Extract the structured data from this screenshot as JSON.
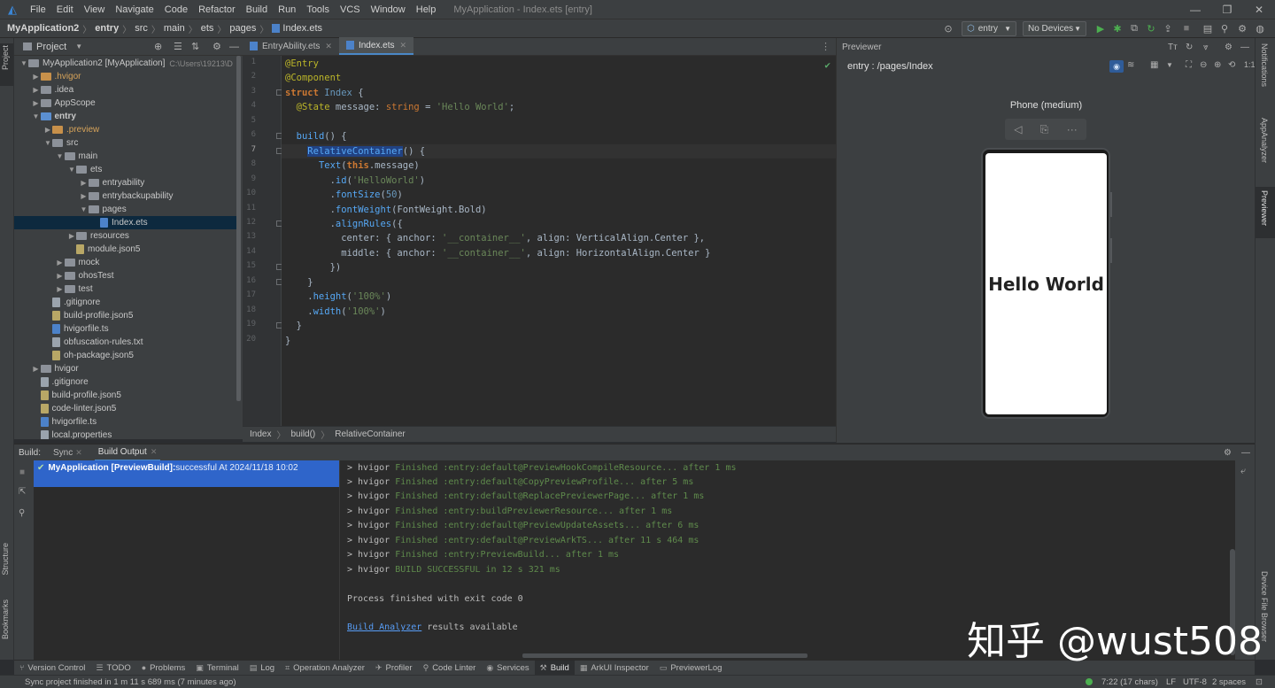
{
  "menubar": {
    "items": [
      "File",
      "Edit",
      "View",
      "Navigate",
      "Code",
      "Refactor",
      "Build",
      "Run",
      "Tools",
      "VCS",
      "Window",
      "Help"
    ],
    "title": "MyApplication - Index.ets [entry]"
  },
  "navbar": {
    "crumbs": [
      "MyApplication2",
      "entry",
      "src",
      "main",
      "ets",
      "pages",
      "Index.ets"
    ],
    "run_config": "entry",
    "device": "No Devices"
  },
  "left_strip": {
    "project": "Project",
    "structure": "Structure",
    "bookmarks": "Bookmarks"
  },
  "project_panel": {
    "title": "Project",
    "tree": [
      {
        "label": "MyApplication2 [MyApplication]",
        "extra": "C:\\Users\\19213\\D",
        "depth": 0,
        "kind": "folder",
        "open": true,
        "bold_part": "[MyApplication]"
      },
      {
        "label": ".hvigor",
        "depth": 1,
        "kind": "folder-orange",
        "open": false
      },
      {
        "label": ".idea",
        "depth": 1,
        "kind": "folder",
        "open": false
      },
      {
        "label": "AppScope",
        "depth": 1,
        "kind": "folder",
        "open": false
      },
      {
        "label": "entry",
        "depth": 1,
        "kind": "folder-blue",
        "open": true
      },
      {
        "label": ".preview",
        "depth": 2,
        "kind": "folder-orange",
        "open": false
      },
      {
        "label": "src",
        "depth": 2,
        "kind": "folder",
        "open": true
      },
      {
        "label": "main",
        "depth": 3,
        "kind": "folder",
        "open": true
      },
      {
        "label": "ets",
        "depth": 4,
        "kind": "folder",
        "open": true
      },
      {
        "label": "entryability",
        "depth": 5,
        "kind": "folder",
        "open": false
      },
      {
        "label": "entrybackupability",
        "depth": 5,
        "kind": "folder",
        "open": false
      },
      {
        "label": "pages",
        "depth": 5,
        "kind": "folder",
        "open": true
      },
      {
        "label": "Index.ets",
        "depth": 6,
        "kind": "file-ts",
        "selected": true
      },
      {
        "label": "resources",
        "depth": 4,
        "kind": "folder",
        "open": false
      },
      {
        "label": "module.json5",
        "depth": 4,
        "kind": "file-json"
      },
      {
        "label": "mock",
        "depth": 3,
        "kind": "folder",
        "open": false
      },
      {
        "label": "ohosTest",
        "depth": 3,
        "kind": "folder",
        "open": false
      },
      {
        "label": "test",
        "depth": 3,
        "kind": "folder",
        "open": false
      },
      {
        "label": ".gitignore",
        "depth": 2,
        "kind": "file"
      },
      {
        "label": "build-profile.json5",
        "depth": 2,
        "kind": "file-json"
      },
      {
        "label": "hvigorfile.ts",
        "depth": 2,
        "kind": "file-ts"
      },
      {
        "label": "obfuscation-rules.txt",
        "depth": 2,
        "kind": "file"
      },
      {
        "label": "oh-package.json5",
        "depth": 2,
        "kind": "file-json"
      },
      {
        "label": "hvigor",
        "depth": 1,
        "kind": "folder",
        "open": false
      },
      {
        "label": ".gitignore",
        "depth": 1,
        "kind": "file"
      },
      {
        "label": "build-profile.json5",
        "depth": 1,
        "kind": "file-json"
      },
      {
        "label": "code-linter.json5",
        "depth": 1,
        "kind": "file-json"
      },
      {
        "label": "hvigorfile.ts",
        "depth": 1,
        "kind": "file-ts"
      },
      {
        "label": "local.properties",
        "depth": 1,
        "kind": "file"
      }
    ]
  },
  "editor": {
    "tabs": [
      {
        "label": "EntryAbility.ets",
        "active": false
      },
      {
        "label": "Index.ets",
        "active": true
      }
    ],
    "current_line": 7,
    "lines": [
      [
        [
          "an",
          "@Entry"
        ]
      ],
      [
        [
          "an",
          "@Component"
        ]
      ],
      [
        [
          "kw",
          "struct "
        ],
        [
          "ty",
          "Index "
        ],
        [
          "id",
          "{"
        ]
      ],
      [
        [
          "id",
          "  "
        ],
        [
          "an",
          "@State "
        ],
        [
          "id",
          "message: "
        ],
        [
          "kwb",
          "string"
        ],
        [
          "id",
          " = "
        ],
        [
          "st",
          "'Hello World'"
        ],
        [
          "id",
          ";"
        ]
      ],
      [],
      [
        [
          "id",
          "  "
        ],
        [
          "fn",
          "build"
        ],
        [
          "id",
          "() {"
        ]
      ],
      [
        [
          "id",
          "    "
        ],
        [
          "fn",
          "RelativeContainer"
        ],
        [
          "id",
          "() {"
        ]
      ],
      [
        [
          "id",
          "      "
        ],
        [
          "fn",
          "Text"
        ],
        [
          "id",
          "("
        ],
        [
          "kw",
          "this"
        ],
        [
          "id",
          ".message)"
        ]
      ],
      [
        [
          "id",
          "        ."
        ],
        [
          "fn",
          "id"
        ],
        [
          "id",
          "("
        ],
        [
          "st",
          "'HelloWorld'"
        ],
        [
          "id",
          ")"
        ]
      ],
      [
        [
          "id",
          "        ."
        ],
        [
          "fn",
          "fontSize"
        ],
        [
          "id",
          "("
        ],
        [
          "ty",
          "50"
        ],
        [
          "id",
          ")"
        ]
      ],
      [
        [
          "id",
          "        ."
        ],
        [
          "fn",
          "fontWeight"
        ],
        [
          "id",
          "(FontWeight.Bold)"
        ]
      ],
      [
        [
          "id",
          "        ."
        ],
        [
          "fn",
          "alignRules"
        ],
        [
          "id",
          "({"
        ]
      ],
      [
        [
          "id",
          "          center: { anchor: "
        ],
        [
          "st",
          "'__container__'"
        ],
        [
          "id",
          ", align: VerticalAlign.Center },"
        ]
      ],
      [
        [
          "id",
          "          middle: { anchor: "
        ],
        [
          "st",
          "'__container__'"
        ],
        [
          "id",
          ", align: HorizontalAlign.Center }"
        ]
      ],
      [
        [
          "id",
          "        })"
        ]
      ],
      [
        [
          "id",
          "    }"
        ]
      ],
      [
        [
          "id",
          "    ."
        ],
        [
          "fn",
          "height"
        ],
        [
          "id",
          "("
        ],
        [
          "st",
          "'100%'"
        ],
        [
          "id",
          ")"
        ]
      ],
      [
        [
          "id",
          "    ."
        ],
        [
          "fn",
          "width"
        ],
        [
          "id",
          "("
        ],
        [
          "st",
          "'100%'"
        ],
        [
          "id",
          ")"
        ]
      ],
      [
        [
          "id",
          "  }"
        ]
      ],
      [
        [
          "id",
          "}"
        ]
      ]
    ],
    "breadcrumbs": [
      "Index",
      "build()",
      "RelativeContainer"
    ]
  },
  "previewer": {
    "panel_title": "Previewer",
    "route": "entry : /pages/Index",
    "device_name": "Phone (medium)",
    "screen_text": "Hello World"
  },
  "right_strip": {
    "notifications": "Notifications",
    "app_analyzer": "AppAnalyzer",
    "previewer": "Previewer",
    "device_file_browser": "Device File Browser"
  },
  "build_panel": {
    "label": "Build:",
    "tabs": [
      {
        "label": "Sync",
        "active": false
      },
      {
        "label": "Build Output",
        "active": true
      }
    ],
    "task_title": "MyApplication [PreviewBuild]:",
    "task_status": " successful At 2024/11/18 10:02",
    "output": [
      {
        "pre": "> hvigor ",
        "text": "Finished :entry:default@PreviewHookCompileResource... after 1 ms",
        "green": true
      },
      {
        "pre": "> hvigor ",
        "text": "Finished :entry:default@CopyPreviewProfile... after 5 ms",
        "green": true
      },
      {
        "pre": "> hvigor ",
        "text": "Finished :entry:default@ReplacePreviewerPage... after 1 ms",
        "green": true
      },
      {
        "pre": "> hvigor ",
        "text": "Finished :entry:buildPreviewerResource... after 1 ms",
        "green": true
      },
      {
        "pre": "> hvigor ",
        "text": "Finished :entry:default@PreviewUpdateAssets... after 6 ms",
        "green": true
      },
      {
        "pre": "> hvigor ",
        "text": "Finished :entry:default@PreviewArkTS... after 11 s 464 ms",
        "green": true
      },
      {
        "pre": "> hvigor ",
        "text": "Finished :entry:PreviewBuild... after 1 ms",
        "green": true
      },
      {
        "pre": "> hvigor ",
        "text": "BUILD SUCCESSFUL in 12 s 321 ms",
        "green": true
      },
      {
        "pre": "",
        "text": "",
        "green": false
      },
      {
        "pre": "Process finished with exit code 0",
        "text": "",
        "green": false
      },
      {
        "pre": "",
        "text": "",
        "green": false
      }
    ],
    "analyzer_link": "Build Analyzer",
    "analyzer_rest": " results available"
  },
  "tool_windows": [
    {
      "label": "Version Control",
      "icon": "⑂"
    },
    {
      "label": "TODO",
      "icon": "☰"
    },
    {
      "label": "Problems",
      "icon": "●"
    },
    {
      "label": "Terminal",
      "icon": "▣"
    },
    {
      "label": "Log",
      "icon": "▤"
    },
    {
      "label": "Operation Analyzer",
      "icon": "⌗"
    },
    {
      "label": "Profiler",
      "icon": "✈"
    },
    {
      "label": "Code Linter",
      "icon": "⚲"
    },
    {
      "label": "Services",
      "icon": "◉"
    },
    {
      "label": "Build",
      "icon": "⚒",
      "active": true
    },
    {
      "label": "ArkUI Inspector",
      "icon": "▦"
    },
    {
      "label": "PreviewerLog",
      "icon": "▭"
    }
  ],
  "statusbar": {
    "message": "Sync project finished in 1 m 11 s 689 ms (7 minutes ago)",
    "position": "7:22 (17 chars)",
    "line_sep": "LF",
    "encoding": "UTF-8",
    "indent": "2 spaces"
  },
  "watermark": "知乎 @wust508",
  "colors": {
    "accent": "#4a88c7",
    "selection": "#2f65ca",
    "success": "#5f8b4c",
    "bg": "#2b2b2b",
    "panel": "#3c3f41"
  }
}
